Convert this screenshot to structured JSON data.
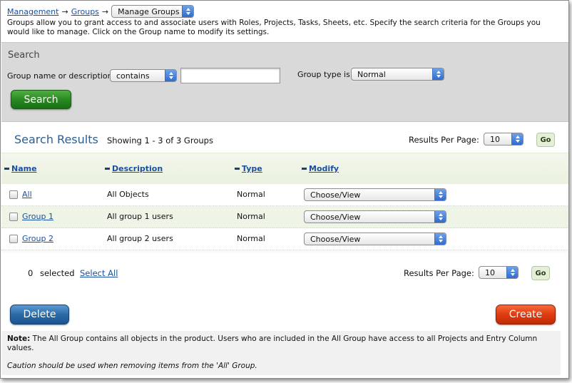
{
  "breadcrumb": {
    "management": "Management",
    "groups": "Groups",
    "arrow": "→",
    "current": "Manage Groups"
  },
  "intro": "Groups allow you to grant access to and associate users with Roles, Projects, Tasks, Sheets, etc. Specify the search criteria for the Groups you would like to manage. Click on the Group name to modify its settings.",
  "search": {
    "title": "Search",
    "name_label": "Group name or description",
    "operator_value": "contains",
    "text_value": "",
    "type_label": "Group type is",
    "type_value": "Normal",
    "button": "Search"
  },
  "results": {
    "title": "Search Results",
    "showing": "Showing 1 - 3 of 3 Groups",
    "per_page_label": "Results Per Page:",
    "per_page_value": "10",
    "go": "Go"
  },
  "table": {
    "headers": {
      "name": "Name",
      "description": "Description",
      "type": "Type",
      "modify": "Modify"
    },
    "rows": [
      {
        "name": "All",
        "description": "All Objects",
        "type": "Normal",
        "modify": "Choose/View"
      },
      {
        "name": "Group 1",
        "description": "All group 1 users",
        "type": "Normal",
        "modify": "Choose/View"
      },
      {
        "name": "Group 2",
        "description": "All group 2 users",
        "type": "Normal",
        "modify": "Choose/View"
      }
    ]
  },
  "footer": {
    "selected_count": "0",
    "selected_label": "selected",
    "select_all": "Select All",
    "per_page_label": "Results Per Page:",
    "per_page_value": "10",
    "go": "Go"
  },
  "actions": {
    "delete": "Delete",
    "create": "Create"
  },
  "note": {
    "label": "Note:",
    "text": " The All Group contains all objects in the product. Users who are included in the All Group have access to all Projects and Entry Column values.",
    "caution": "Caution should be used when removing items from the 'All' Group."
  },
  "colors": {
    "link": "#1a4fa0",
    "search_panel": "#d9d9d9",
    "results_title": "#2d5e8e",
    "search_button": "#2a8a23",
    "delete_button": "#2c6aa7",
    "create_button": "#de3b10"
  },
  "icons": {
    "select_spinner": "updown-arrows-icon"
  }
}
